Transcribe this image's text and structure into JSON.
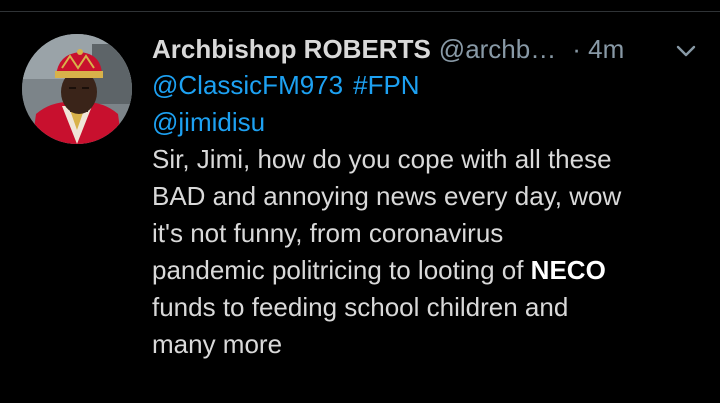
{
  "tweet": {
    "display_name": "Archbishop ROBERTS",
    "handle": "@archb…",
    "time": "· 4m",
    "menu_icon": "chevron-down-icon",
    "avatar_icon": "avatar",
    "colors": {
      "background": "#000000",
      "text": "#d9d9d9",
      "secondary_text": "#8899a6",
      "link": "#1da1f2"
    },
    "mentions": {
      "classicfm": "@ClassicFM973",
      "jimidisu": "@jimidisu"
    },
    "hashtag": "#FPN",
    "body": {
      "line1": "Sir, Jimi, how do you cope with all these",
      "line2": "BAD and annoying news every day, wow",
      "line3": "it's not funny, from coronavirus",
      "line4_prefix": "pandemic politricing to looting of ",
      "line4_bold": "NECO",
      "line5": "funds to feeding school children and",
      "line6": "many more"
    }
  }
}
